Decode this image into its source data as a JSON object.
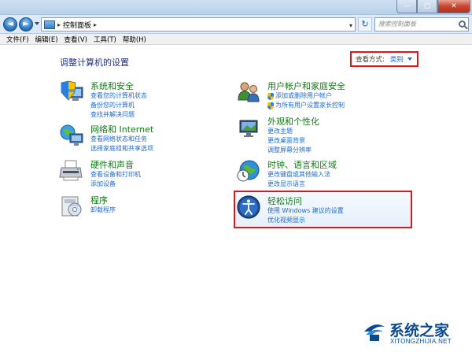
{
  "window": {
    "minimize_glyph": "—",
    "maximize_glyph": "□",
    "close_glyph": "✕"
  },
  "address": {
    "back_glyph": "◄",
    "forward_glyph": "►",
    "breadcrumb_sep": "▸",
    "location": "控制面板",
    "location_suffix": "▸",
    "dropdown_glyph": "▾",
    "refresh_glyph": "↻",
    "search_placeholder": "搜索控制面板"
  },
  "menu": [
    "文件(F)",
    "编辑(E)",
    "查看(V)",
    "工具(T)",
    "帮助(H)"
  ],
  "page_title": "调整计算机的设置",
  "view_by": {
    "label": "查看方式:",
    "value": "类别"
  },
  "categories": [
    {
      "title": "系统和安全",
      "icon": "shield-computer-icon",
      "links": [
        "查看您的计算机状态",
        "备份您的计算机",
        "查找并解决问题"
      ]
    },
    {
      "title": "网络和 Internet",
      "icon": "network-globe-icon",
      "links": [
        "查看网络状态和任务",
        "选择家庭组和共享选项"
      ]
    },
    {
      "title": "硬件和声音",
      "icon": "printer-icon",
      "links": [
        "查看设备和打印机",
        "添加设备"
      ]
    },
    {
      "title": "程序",
      "icon": "programs-icon",
      "links": [
        "卸载程序"
      ]
    },
    {
      "title": "用户帐户和家庭安全",
      "icon": "users-icon",
      "links": [
        "添加或删除用户帐户",
        "为所有用户设置家长控制"
      ],
      "shielded": [
        true,
        true
      ]
    },
    {
      "title": "外观和个性化",
      "icon": "display-icon",
      "links": [
        "更改主题",
        "更改桌面背景",
        "调整屏幕分辨率"
      ]
    },
    {
      "title": "时钟、语言和区域",
      "icon": "clock-globe-icon",
      "links": [
        "更改键盘或其他输入法",
        "更改显示语言"
      ]
    },
    {
      "title": "轻松访问",
      "icon": "ease-of-access-icon",
      "links": [
        "使用 Windows 建议的设置",
        "优化视频显示"
      ]
    }
  ],
  "watermark": {
    "main": "系统之家",
    "sub": "XITONGZHIJIA.NET"
  },
  "colors": {
    "category_title": "#117b16",
    "link": "#1c6bd4",
    "page_title": "#1e3287",
    "highlight_border": "#e0161d"
  }
}
